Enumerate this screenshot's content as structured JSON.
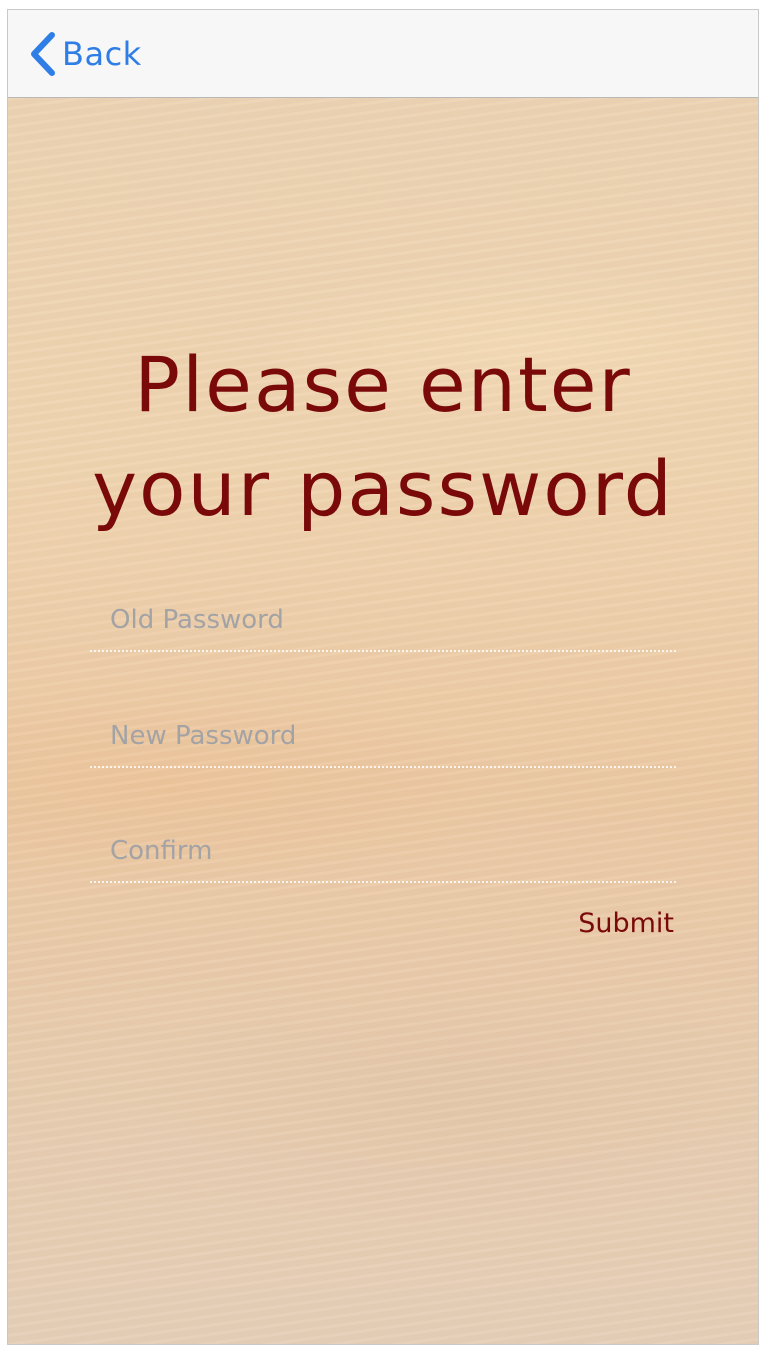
{
  "navbar": {
    "back_label": "Back",
    "back_icon": "chevron-left-icon"
  },
  "main": {
    "title_line1": "Please enter",
    "title_line2": "your password",
    "fields": {
      "old_password": {
        "placeholder": "Old Password",
        "value": ""
      },
      "new_password": {
        "placeholder": "New Password",
        "value": ""
      },
      "confirm": {
        "placeholder": "Confirm",
        "value": ""
      }
    },
    "submit_label": "Submit"
  },
  "colors": {
    "accent": "#2f7ee6",
    "title": "#7a0a0a",
    "placeholder": "#a3a3a6",
    "navbar_bg": "#f7f7f7"
  }
}
